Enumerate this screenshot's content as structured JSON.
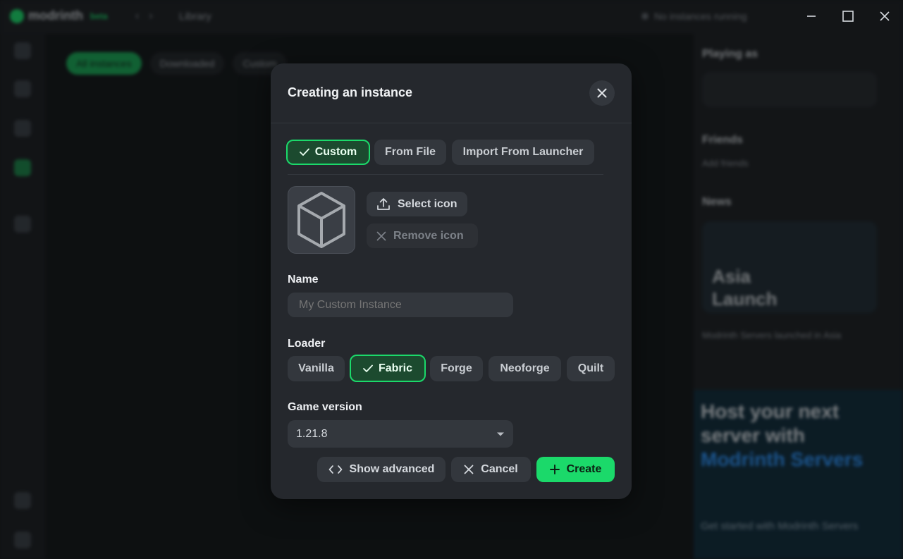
{
  "app": {
    "brand": "modrinth",
    "beta_badge": "beta",
    "breadcrumb": "Library",
    "status": "No instances running",
    "accent": "#1bd96a"
  },
  "background": {
    "tabs": [
      "All instances",
      "Downloaded",
      "Custom"
    ],
    "right_panel": {
      "playing_as": "Playing as",
      "friends": "Friends",
      "friends_hint": "Add friends",
      "news": "News",
      "news_headline": "Asia Launch",
      "news_sub": "Modrinth Servers launched in Asia",
      "promo_line1": "Host your next server with",
      "promo_highlight": "Modrinth Servers",
      "promo_footer": "Get started with Modrinth Servers"
    }
  },
  "window_controls": {
    "minimize_icon": "minimize-icon",
    "maximize_icon": "maximize-icon",
    "close_icon": "close-icon"
  },
  "modal": {
    "title": "Creating an instance",
    "source_tabs": [
      {
        "label": "Custom",
        "selected": true
      },
      {
        "label": "From File",
        "selected": false
      },
      {
        "label": "Import From Launcher",
        "selected": false
      }
    ],
    "select_icon_label": "Select icon",
    "remove_icon_label": "Remove icon",
    "name_label": "Name",
    "name_placeholder": "My Custom Instance",
    "name_value": "",
    "loader_label": "Loader",
    "loaders": [
      {
        "label": "Vanilla",
        "selected": false
      },
      {
        "label": "Fabric",
        "selected": true
      },
      {
        "label": "Forge",
        "selected": false
      },
      {
        "label": "Neoforge",
        "selected": false
      },
      {
        "label": "Quilt",
        "selected": false
      }
    ],
    "game_version_label": "Game version",
    "game_version_value": "1.21.8",
    "show_advanced_label": "Show advanced",
    "cancel_label": "Cancel",
    "create_label": "Create"
  }
}
